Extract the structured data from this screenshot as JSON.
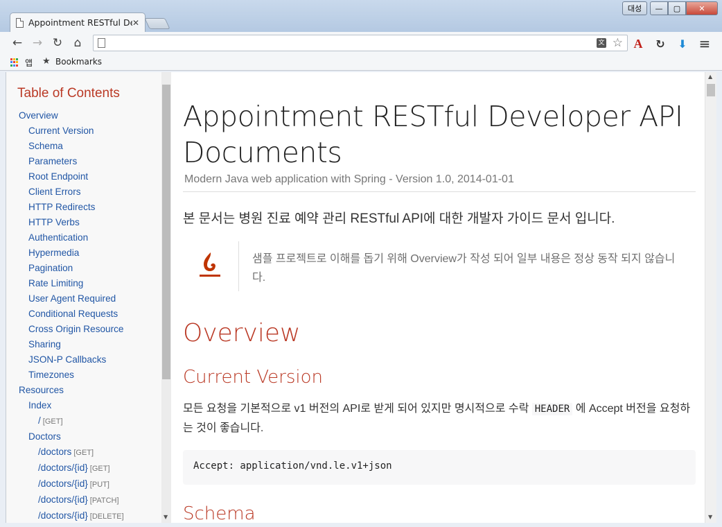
{
  "window": {
    "tab_title": "Appointment RESTful De",
    "tab_close": "✕",
    "user_button": "대성",
    "minimize": "—",
    "maximize": "▢",
    "close": "✕"
  },
  "toolbar": {
    "back": "←",
    "forward": "→",
    "reload": "↻",
    "home": "⌂",
    "address_value": "",
    "translate_glyph": "文",
    "star": "☆",
    "acrobat": "A",
    "sync": "↻",
    "download": "⬇",
    "menu": "≡"
  },
  "bookmarks": {
    "apps_label": "앱",
    "bookmarks_label": "Bookmarks",
    "star_icon": "★"
  },
  "toc": {
    "title": "Table of Contents",
    "items": [
      {
        "label": "Overview",
        "level": 1,
        "verb": ""
      },
      {
        "label": "Current Version",
        "level": 2,
        "verb": ""
      },
      {
        "label": "Schema",
        "level": 2,
        "verb": ""
      },
      {
        "label": "Parameters",
        "level": 2,
        "verb": ""
      },
      {
        "label": "Root Endpoint",
        "level": 2,
        "verb": ""
      },
      {
        "label": "Client Errors",
        "level": 2,
        "verb": ""
      },
      {
        "label": "HTTP Redirects",
        "level": 2,
        "verb": ""
      },
      {
        "label": "HTTP Verbs",
        "level": 2,
        "verb": ""
      },
      {
        "label": "Authentication",
        "level": 2,
        "verb": ""
      },
      {
        "label": "Hypermedia",
        "level": 2,
        "verb": ""
      },
      {
        "label": "Pagination",
        "level": 2,
        "verb": ""
      },
      {
        "label": "Rate Limiting",
        "level": 2,
        "verb": ""
      },
      {
        "label": "User Agent Required",
        "level": 2,
        "verb": ""
      },
      {
        "label": "Conditional Requests",
        "level": 2,
        "verb": ""
      },
      {
        "label": "Cross Origin Resource",
        "level": 2,
        "verb": ""
      },
      {
        "label": "Sharing",
        "level": 2,
        "verb": ""
      },
      {
        "label": "JSON-P Callbacks",
        "level": 2,
        "verb": ""
      },
      {
        "label": "Timezones",
        "level": 2,
        "verb": ""
      },
      {
        "label": "Resources",
        "level": 1,
        "verb": ""
      },
      {
        "label": "Index",
        "level": 2,
        "verb": ""
      },
      {
        "label": "/",
        "level": 3,
        "verb": "[GET]"
      },
      {
        "label": "Doctors",
        "level": 2,
        "verb": ""
      },
      {
        "label": "/doctors",
        "level": 3,
        "verb": "[GET]"
      },
      {
        "label": "/doctors/{id}",
        "level": 3,
        "verb": "[GET]"
      },
      {
        "label": "/doctors/{id}",
        "level": 3,
        "verb": "[PUT]"
      },
      {
        "label": "/doctors/{id}",
        "level": 3,
        "verb": "[PATCH]"
      },
      {
        "label": "/doctors/{id}",
        "level": 3,
        "verb": "[DELETE]"
      }
    ],
    "scroll_down": "▼"
  },
  "content": {
    "title": "Appointment RESTful Developer API Documents",
    "subtitle": "Modern Java web application with Spring - Version 1.0, 2014-01-01",
    "lead": "본 문서는 병원 진료 예약 관리 RESTful API에 대한 개발자 가이드 문서 입니다.",
    "tip_text": "샘플 프로젝트로 이해를 돕기 위해 Overview가 작성 되어 일부 내용은 정상 동작 되지 않습니다.",
    "overview_heading": "Overview",
    "current_version_heading": "Current Version",
    "para_before": "모든 요청을 기본적으로 v1 버전의 API로 받게 되어 있지만 명시적으로 수락 ",
    "para_code": "HEADER",
    "para_after": " 에 Accept 버전을 요청하는 것이 좋습니다.",
    "code_listing": "Accept: application/vnd.le.v1+json",
    "schema_heading": "Schema"
  },
  "scrollbar": {
    "up": "▲",
    "down": "▼"
  },
  "colors": {
    "heading": "#ba3925",
    "link": "#2156a5",
    "tip_icon": "#bf3400"
  }
}
